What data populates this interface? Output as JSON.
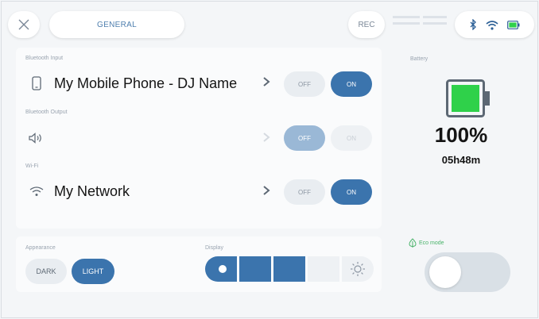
{
  "header": {
    "tab_general": "GENERAL",
    "rec_label": "REC",
    "status_icons": [
      "bluetooth-icon",
      "wifi-icon",
      "battery-icon"
    ]
  },
  "bluetooth_input": {
    "section_label": "Bluetooth Input",
    "device_name": "My Mobile Phone - DJ Name",
    "off_label": "OFF",
    "on_label": "ON",
    "state": "on"
  },
  "bluetooth_output": {
    "section_label": "Bluetooth Output",
    "off_label": "OFF",
    "on_label": "ON",
    "state": "off",
    "disabled": true
  },
  "wifi": {
    "section_label": "Wi-Fi",
    "network_name": "My Network",
    "off_label": "OFF",
    "on_label": "ON",
    "state": "on"
  },
  "appearance": {
    "section_label": "Appearance",
    "dark_label": "DARK",
    "light_label": "LIGHT",
    "selected": "light"
  },
  "display": {
    "section_label": "Display",
    "brightness_level": 2,
    "brightness_max": 3
  },
  "battery": {
    "section_label": "Battery",
    "percent_text": "100%",
    "time_remaining": "05h48m",
    "level_percent": 100
  },
  "eco_mode": {
    "label": "Eco mode",
    "enabled": false
  },
  "colors": {
    "accent": "#3b74ad",
    "battery_fill": "#2fd14a",
    "eco_green": "#4ab36a"
  }
}
